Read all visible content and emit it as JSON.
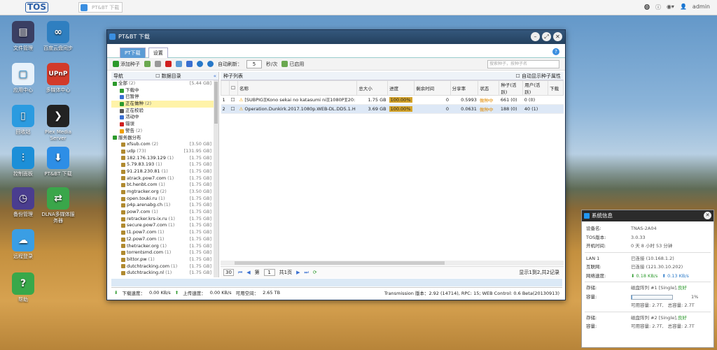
{
  "topbar": {
    "logo": "TOS",
    "app_tab": "PT&BT 下载",
    "user": "admin"
  },
  "desktop": [
    {
      "label": "文件管理",
      "color": "#3a3f63",
      "glyph": "▤"
    },
    {
      "label": "百度云盘同步",
      "color": "#2f7fc0",
      "glyph": "∞"
    },
    {
      "label": "应用中心",
      "color": "#e8f2fb",
      "glyph": "▢"
    },
    {
      "label": "多媒体中心",
      "color": "#d23a2a",
      "glyph": "UPnP"
    },
    {
      "label": "回收站",
      "color": "#2b9be0",
      "glyph": "▯"
    },
    {
      "label": "Plex Media Server",
      "color": "#222",
      "glyph": "❯"
    },
    {
      "label": "控制面板",
      "color": "#1c8fd8",
      "glyph": "⫶"
    },
    {
      "label": "PT&BT 下载",
      "color": "#2d8ee6",
      "glyph": "⬇"
    },
    {
      "label": "备份管理",
      "color": "#4a3d8f",
      "glyph": "◷"
    },
    {
      "label": "DLNA多媒体服务器",
      "color": "#3aa64a",
      "glyph": "⇄"
    },
    {
      "label": "远程登录",
      "color": "#3a9ee4",
      "glyph": "☁"
    },
    {
      "label": "帮助",
      "color": "#38a84a",
      "glyph": "?"
    }
  ],
  "window": {
    "title": "PT&BT 下载",
    "tabs": [
      "PT下载",
      "设置"
    ],
    "toolbar": {
      "add_label": "添加种子",
      "auto_refresh_label": "自动刷新：",
      "refresh_value": "5",
      "refresh_unit": "秒/次",
      "enabled_label": "已启用",
      "search_placeholder": "搜索种子，按种子名"
    },
    "nav": {
      "header": "导航",
      "data_dir": "数据目录",
      "items": [
        {
          "name": "全部",
          "count": "(2)",
          "size": "[5.44 GB]",
          "color": "#2c9a2c",
          "sel": false
        },
        {
          "name": "下载中",
          "count": "",
          "size": "",
          "color": "#2c9a2c",
          "sel": false
        },
        {
          "name": "已暂停",
          "count": "",
          "size": "",
          "color": "#3a6fd0",
          "sel": false
        },
        {
          "name": "正在做种",
          "count": "(2)",
          "size": "",
          "color": "#2c9a2c",
          "sel": true
        },
        {
          "name": "正在校验",
          "count": "",
          "size": "",
          "color": "#555",
          "sel": false
        },
        {
          "name": "活动中",
          "count": "",
          "size": "",
          "color": "#3a6fd0",
          "sel": false
        },
        {
          "name": "错误",
          "count": "",
          "size": "",
          "color": "#d02020",
          "sel": false
        },
        {
          "name": "警告",
          "count": "(2)",
          "size": "",
          "color": "#f0a000",
          "sel": false
        },
        {
          "name": "服务器分布",
          "count": "",
          "size": "",
          "color": "#2c9a2c",
          "sel": false
        },
        {
          "name": "xfsub.com",
          "count": "(2)",
          "size": "[3.50 GB]",
          "color": "#b08a30",
          "sel": false
        },
        {
          "name": "udp",
          "count": "(73)",
          "size": "[131.95 GB]",
          "color": "#b08a30",
          "sel": false
        },
        {
          "name": "182.176.139.129",
          "count": "(1)",
          "size": "[1.75 GB]",
          "color": "#b08a30",
          "sel": false
        },
        {
          "name": "5.79.83.193",
          "count": "(1)",
          "size": "[1.75 GB]",
          "color": "#b08a30",
          "sel": false
        },
        {
          "name": "91.218.230.81",
          "count": "(1)",
          "size": "[1.75 GB]",
          "color": "#b08a30",
          "sel": false
        },
        {
          "name": "atrack.pow7.com",
          "count": "(1)",
          "size": "[1.75 GB]",
          "color": "#b08a30",
          "sel": false
        },
        {
          "name": "bt.henbt.com",
          "count": "(1)",
          "size": "[1.75 GB]",
          "color": "#b08a30",
          "sel": false
        },
        {
          "name": "mgtracker.org",
          "count": "(2)",
          "size": "[3.50 GB]",
          "color": "#b08a30",
          "sel": false
        },
        {
          "name": "open.touki.ru",
          "count": "(1)",
          "size": "[1.75 GB]",
          "color": "#b08a30",
          "sel": false
        },
        {
          "name": "p4p.arenabg.ch",
          "count": "(1)",
          "size": "[1.75 GB]",
          "color": "#b08a30",
          "sel": false
        },
        {
          "name": "pow7.com",
          "count": "(1)",
          "size": "[1.75 GB]",
          "color": "#b08a30",
          "sel": false
        },
        {
          "name": "retracker.krs-ix.ru",
          "count": "(1)",
          "size": "[1.75 GB]",
          "color": "#b08a30",
          "sel": false
        },
        {
          "name": "secure.pow7.com",
          "count": "(1)",
          "size": "[1.75 GB]",
          "color": "#b08a30",
          "sel": false
        },
        {
          "name": "t1.pow7.com",
          "count": "(1)",
          "size": "[1.75 GB]",
          "color": "#b08a30",
          "sel": false
        },
        {
          "name": "t2.pow7.com",
          "count": "(1)",
          "size": "[1.75 GB]",
          "color": "#b08a30",
          "sel": false
        },
        {
          "name": "thetracker.org",
          "count": "(1)",
          "size": "[1.75 GB]",
          "color": "#b08a30",
          "sel": false
        },
        {
          "name": "torrentsmd.com",
          "count": "(1)",
          "size": "[1.75 GB]",
          "color": "#b08a30",
          "sel": false
        },
        {
          "name": "bittor.pw",
          "count": "(1)",
          "size": "[1.75 GB]",
          "color": "#b08a30",
          "sel": false
        },
        {
          "name": "dutchtracking.com",
          "count": "(1)",
          "size": "[1.75 GB]",
          "color": "#b08a30",
          "sel": false
        },
        {
          "name": "dutchtracking.nl",
          "count": "(1)",
          "size": "[1.75 GB]",
          "color": "#b08a30",
          "sel": false
        }
      ]
    },
    "list": {
      "header": "种子列表",
      "auto_show": "自动显示种子属性",
      "columns": [
        "",
        "",
        "名称",
        "总大小",
        "进度",
        "剩余时间",
        "分享率",
        "状态",
        "种子(活跃)",
        "用户(活跃)",
        "下载"
      ],
      "rows": [
        {
          "idx": "1",
          "name": "[SUBPIG][Kono sekai no katasumi ni][1080P][20:",
          "size": "1.75 GB",
          "progress": "100.00%",
          "remaining": "0",
          "ratio": "0.5993",
          "status": "做种中",
          "seeds": "661 (0)",
          "peers": "0 (0)",
          "dl": ""
        },
        {
          "idx": "2",
          "name": "Operation.Dunkirk.2017.1080p.WEB-DL.DD5.1.H",
          "size": "3.69 GB",
          "progress": "100.00%",
          "remaining": "0",
          "ratio": "0.0631",
          "status": "做种中",
          "seeds": "188 (0)",
          "peers": "40 (1)",
          "dl": ""
        }
      ]
    },
    "pager": {
      "page_size": "30",
      "page_label": "第",
      "page": "1",
      "of": "共1页",
      "info": "显示1到2,共2记录"
    },
    "status": {
      "down_label": "下载速度：",
      "down": "0.00 KB/s",
      "up_label": "上传速度：",
      "up": "0.00 KB/s",
      "free_label": "可用空间：",
      "free": "2.65 TB",
      "version": "Transmission 版本：2.92 (14714), RPC: 15; WEB Control: 0.6 Beta(20130913)"
    }
  },
  "sysinfo": {
    "title": "系统信息",
    "device_k": "设备名:",
    "device_v": "TNAS-2A04",
    "tos_k": "TOS版本:",
    "tos_v": "3.0.33",
    "uptime_k": "开机时间:",
    "uptime_v": "0 天 8 小时 53 分钟",
    "lan_k": "LAN 1",
    "lan_v": "已连接 (10.168.1.2)",
    "inet_k": "互联网:",
    "inet_v": "已连接 (121.30.10.202)",
    "speed_k": "网络速度:",
    "speed_down": "0.18 KB/s",
    "speed_up": "0.13 KB/s",
    "storage1_k": "存储:",
    "storage1_v": "磁盘阵列 #1 [Single],",
    "storage1_ok": "良好",
    "cap1_k": "容量:",
    "cap1_pct": "1%",
    "cap1_fill": 0.01,
    "cap1_avail": "可用容量: 2.7T,",
    "cap1_total": "总容量: 2.7T",
    "storage2_k": "存储:",
    "storage2_v": "磁盘阵列 #2 [Single],",
    "storage2_ok": "良好",
    "cap2_k": "容量:",
    "cap2_avail": "可用容量: 2.7T,",
    "cap2_total": "总容量: 2.7T"
  }
}
